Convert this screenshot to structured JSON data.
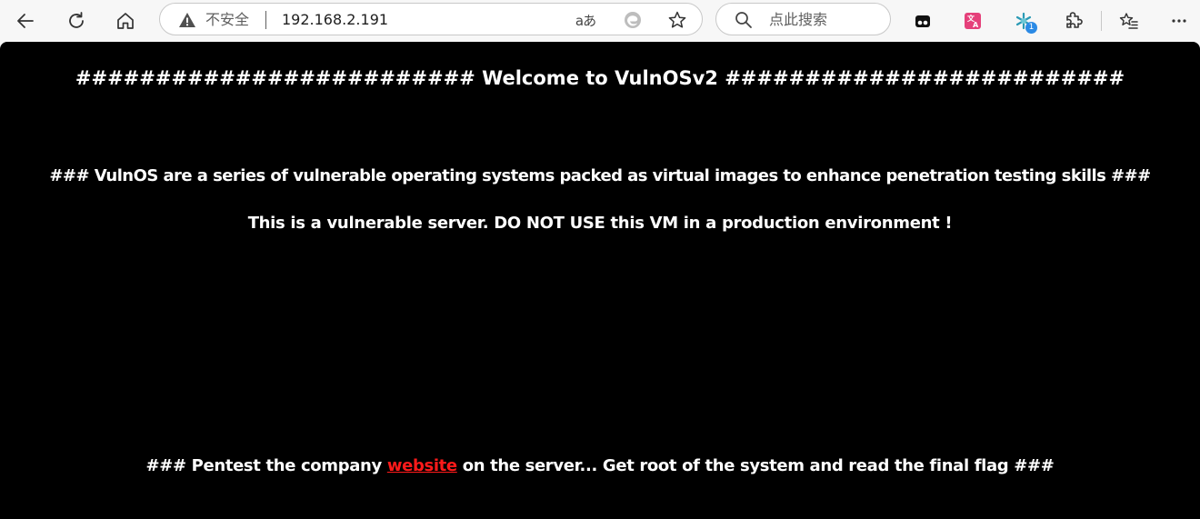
{
  "toolbar": {
    "back_icon": "back-arrow-icon",
    "refresh_icon": "refresh-icon",
    "home_icon": "home-icon"
  },
  "address_bar": {
    "security_label": "不安全",
    "url": "192.168.2.191",
    "warning_icon": "warning-triangle-icon",
    "read_aloud_label": "aあ",
    "favorite_icon": "star-icon"
  },
  "search": {
    "placeholder": "点此搜索"
  },
  "extensions": {
    "badge_count": "1"
  },
  "colors": {
    "page_background": "#000000",
    "page_text": "#ffffff",
    "link": "#ff1a1a",
    "chrome_background": "#f7f7f7"
  },
  "page": {
    "title": "######################### Welcome to VulnOSv2 #########################",
    "description": "### VulnOS are a series of vulnerable operating systems packed as virtual images to enhance penetration testing skills ###",
    "warning": "This is a vulnerable server. DO NOT USE this VM in a production environment !",
    "task_prefix": "### Pentest the company ",
    "task_link": "website",
    "task_suffix": " on the server... Get root of the system and read the final flag ###"
  }
}
